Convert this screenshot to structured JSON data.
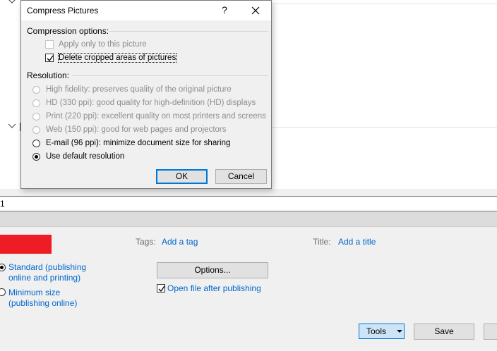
{
  "background": {
    "filename_value": "1",
    "tags_label": "Tags:",
    "tags_link": "Add a tag",
    "title_label": "Title:",
    "title_link": "Add a title",
    "optimize": {
      "standard_line1": "Standard (publishing",
      "standard_line2": "online and printing)",
      "minimum_line1": "Minimum size",
      "minimum_line2": "(publishing online)"
    },
    "options_button": "Options...",
    "open_after_publishing": "Open file after publishing",
    "tools_button": "Tools",
    "save_button": "Save",
    "colors": {
      "brand_red": "#ee1c25",
      "link": "#0066cc"
    }
  },
  "dialog": {
    "title": "Compress Pictures",
    "help_glyph": "?",
    "compression": {
      "heading": "Compression options:",
      "apply_only": "Apply only to this picture",
      "delete_cropped": "Delete cropped areas of pictures"
    },
    "resolution": {
      "heading": "Resolution:",
      "options": [
        {
          "label": "High fidelity: preserves quality of the original picture",
          "enabled": false,
          "selected": false
        },
        {
          "label": "HD (330 ppi): good quality for high-definition (HD) displays",
          "enabled": false,
          "selected": false
        },
        {
          "label": "Print (220 ppi): excellent quality on most printers and screens",
          "enabled": false,
          "selected": false
        },
        {
          "label": "Web (150 ppi): good for web pages and projectors",
          "enabled": false,
          "selected": false
        },
        {
          "label": "E-mail (96 ppi): minimize document size for sharing",
          "enabled": true,
          "selected": false
        },
        {
          "label": "Use default resolution",
          "enabled": true,
          "selected": true
        }
      ]
    },
    "ok_button": "OK",
    "cancel_button": "Cancel"
  }
}
